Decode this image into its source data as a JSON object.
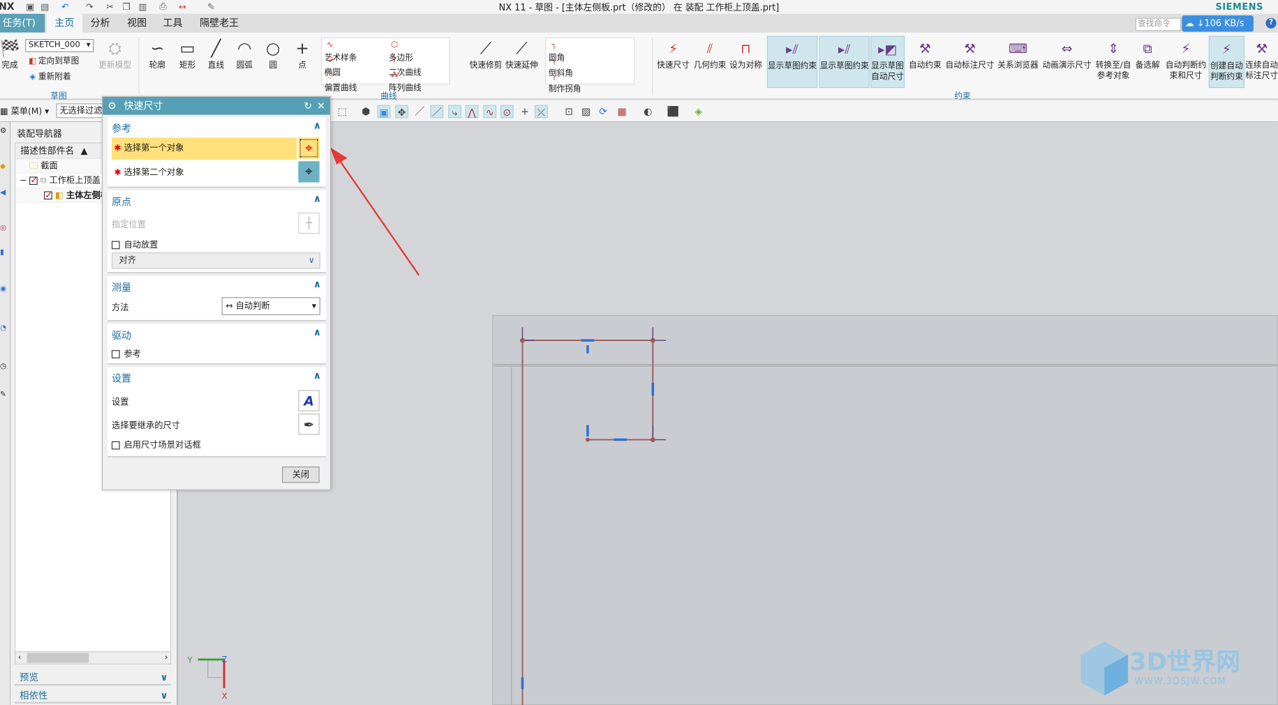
{
  "title_bar": {
    "title": "NX 11 - 草图 - [主体左侧板.prt（修改的） 在 装配 工作柜上顶盖.prt]",
    "brand": "SIEMENS",
    "logo": "NX",
    "quick_access": [
      "save-icon",
      "save-all-icon",
      "undo-icon",
      "redo-icon",
      "cut-icon",
      "copy-icon",
      "paste-icon",
      "print-icon",
      "quick-dimension-icon",
      "touch-mode-icon"
    ]
  },
  "tabs": [
    "任务(T)",
    "主页",
    "分析",
    "视图",
    "工具",
    "隔壁老王"
  ],
  "active_tab": "主页",
  "search": {
    "placeholder": "查找命令"
  },
  "download_speed": "106 KB/s",
  "ribbon": {
    "sketch": {
      "label": "草图",
      "finish": "完成",
      "sketch_name": "SKETCH_000",
      "orient": "定向到草图",
      "reattach": "重新附着",
      "update": "更新模型"
    },
    "curve": {
      "label": "曲线",
      "big": [
        "轮廓",
        "矩形",
        "直线",
        "圆弧",
        "圆",
        "点"
      ],
      "small": [
        "艺术样条",
        "椭圆",
        "偏置曲线",
        "多边形",
        "二次曲线",
        "阵列曲线"
      ],
      "edit": [
        "快速修剪",
        "快速延伸"
      ],
      "corner": [
        "圆角",
        "倒斜角",
        "制作拐角"
      ]
    },
    "constraint": {
      "label": "约束",
      "items": [
        "快速尺寸",
        "几何约束",
        "设为对称",
        "显示草图约束",
        "显示草图约束",
        "显示草图\n自动尺寸",
        "自动约束",
        "自动标注尺寸",
        "关系浏览器",
        "动画演示尺寸",
        "转换至/自\n参考对象",
        "备选解",
        "自动判断约\n束和尺寸",
        "创建自动\n判断约束",
        "连续自动\n标注尺寸"
      ],
      "highlighted": [
        3,
        4,
        5,
        13
      ]
    }
  },
  "toolbar": {
    "menu": "菜单(M)",
    "filter": "无选择过滤器"
  },
  "navigator": {
    "title": "装配导航器",
    "column": "描述性部件名",
    "tree": [
      {
        "label": "截面",
        "checked": null
      },
      {
        "label": "工作柜上顶盖",
        "checked": true
      },
      {
        "label": "主体左侧板",
        "checked": true
      }
    ],
    "panels": [
      "预览",
      "相依性"
    ]
  },
  "dialog": {
    "title": "快速尺寸",
    "reference": {
      "header": "参考",
      "first": "选择第一个对象",
      "second": "选择第二个对象"
    },
    "origin": {
      "header": "原点",
      "specify": "指定位置",
      "auto_place": "自动放置",
      "auto_place_checked": false,
      "align": "对齐"
    },
    "measure": {
      "header": "测量",
      "method_label": "方法",
      "method": "自动判断"
    },
    "drive": {
      "header": "驱动",
      "reference": "参考",
      "reference_checked": false
    },
    "settings": {
      "header": "设置",
      "settings": "设置",
      "inherit": "选择要继承的尺寸",
      "enable_scene": "启用尺寸场景对话框",
      "enable_scene_checked": false
    },
    "close": "关闭"
  },
  "triad": {
    "x": "X",
    "y": "Y",
    "z": "Z"
  },
  "watermark": {
    "name": "3D世界网",
    "url": "WWW.3DSJW.COM"
  },
  "colors": {
    "accent": "#56a0b6",
    "sketch_curve": "#9c5a5a",
    "constraint": "#2f6fd6",
    "selection": "#ffe07a"
  }
}
